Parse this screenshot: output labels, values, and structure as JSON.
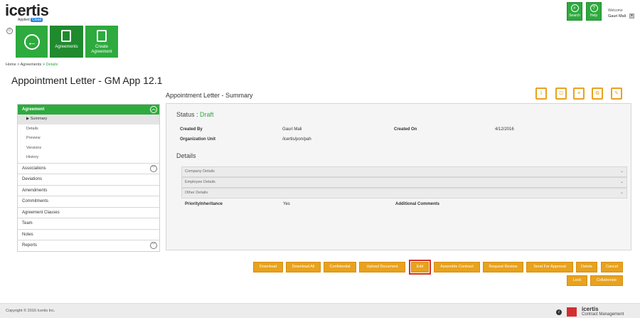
{
  "header": {
    "logo_text": "icertis",
    "logo_sub": "Applied",
    "logo_cloud": "Cloud",
    "search_label": "Search",
    "help_label": "Help",
    "welcome": "Welcome",
    "user": "Gauri Mali"
  },
  "tiles": {
    "agreements": "Agreements",
    "create_line1": "Create",
    "create_line2": "Agreement"
  },
  "breadcrumb": [
    "Home",
    "Agreements",
    "Details"
  ],
  "page_title": "Appointment Letter - GM App 12.1",
  "sidebar": {
    "header": "Agreement",
    "subitems": [
      "Summary",
      "Details",
      "Preview",
      "Versions",
      "History"
    ],
    "items": [
      "Associations",
      "Deviations",
      "Amendments",
      "Commitments",
      "Agreement Clauses",
      "Team",
      "Notes",
      "Reports"
    ]
  },
  "summary": {
    "heading": "Appointment Letter - Summary",
    "status_label": "Status :",
    "status_value": "Draft",
    "created_by_label": "Created By",
    "created_by_value": "Gauri Mali",
    "created_on_label": "Created On",
    "created_on_value": "4/12/2016",
    "org_unit_label": "Organization Unit",
    "org_unit_value": "/icertis/pon/pah",
    "details_heading": "Details",
    "sections": [
      "Company Details",
      "Employee Details",
      "Other Details"
    ],
    "priority_label": "PriorityInheritance",
    "priority_value": "Yes",
    "comments_label": "Additional Comments"
  },
  "actions": {
    "download": "Download",
    "download_all": "Download All",
    "confidential": "Confidential",
    "upload": "Upload Document",
    "edit": "Edit",
    "assemble": "Assemble Contract",
    "request_review": "Request Review",
    "send_approval": "Send For Approval",
    "delete": "Delete",
    "cancel": "Cancel",
    "lock": "Lock",
    "collaborate": "Collaborate"
  },
  "footer": {
    "copyright": "Copyright © 2016 Icertis Inc.",
    "brand": "icertis",
    "brand_sub": "Contract Management"
  },
  "colors": {
    "accent_green": "#2eaa3e",
    "action_orange": "#e8a21d",
    "highlight_red": "#d32f2f"
  }
}
